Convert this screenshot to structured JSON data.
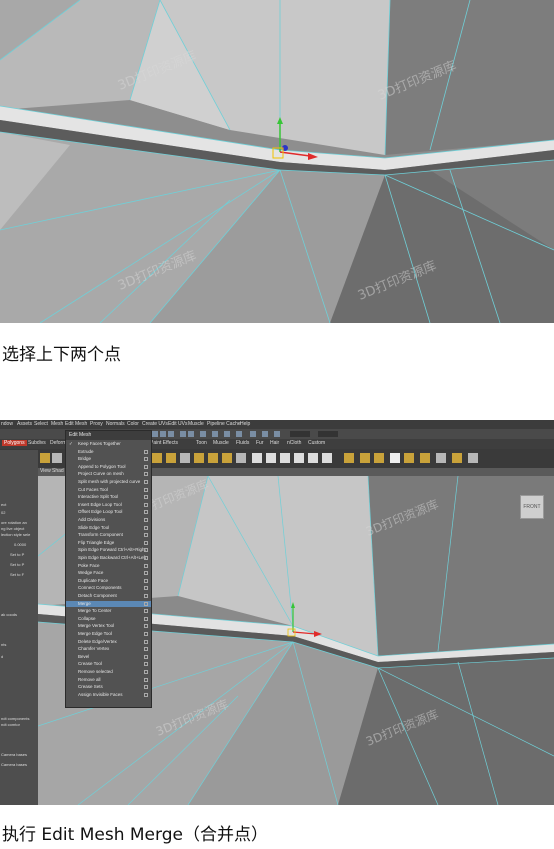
{
  "captions": {
    "step1": "选择上下两个点",
    "step2": "执行 Edit Mesh    Merge（合并点）"
  },
  "maya": {
    "menubar": [
      "ndow",
      "Assets",
      "Select",
      "Mesh",
      "Edit Mesh",
      "Proxy",
      "Normals",
      "Color",
      "Create UVs",
      "Edit UVs",
      "Muscle",
      "Pipeline Cache",
      "Help"
    ],
    "shelf_tabs": [
      "Polygons",
      "Subdivs",
      "Deform"
    ],
    "shelf_tabs_right": [
      "Fluids",
      "Fur",
      "Hair",
      "nCloth",
      "Custom",
      "Paint Effects",
      "Toon",
      "Muscle"
    ],
    "viewcube_label": "FRONT",
    "left_panel": [
      "ect",
      "02",
      "ore rotation an",
      "ng live object",
      "lection style sele",
      "0.0000",
      "Set to P",
      "Set to P",
      "Set to F",
      "ak coods",
      "nts",
      "d",
      "ndt components",
      "ndt comtor",
      "Camera bases",
      "Camera bases"
    ],
    "viewport_menu": [
      "View",
      "Shad"
    ],
    "edit_mesh_menu": {
      "title": "Edit Mesh",
      "highlighted": "Merge",
      "items": [
        "Keep Faces Together",
        "Extrude",
        "Bridge",
        "Append to Polygon Tool",
        "Project Curve on mesh",
        "Split mesh with projected curve",
        "Cut Faces Tool",
        "Interactive Split Tool",
        "Insert Edge Loop Tool",
        "Offset Edge Loop Tool",
        "Add Divisions",
        "Slide Edge Tool",
        "Transform Component",
        "Flip Triangle Edge",
        "Spin Edge Forward Ctrl+Alt+Right",
        "Spin Edge Backward Ctrl+Alt+Left",
        "Poke Face",
        "Wedge Face",
        "Duplicate Face",
        "Connect Components",
        "Detach Component",
        "Merge",
        "Merge To Center",
        "Collapse",
        "Merge Vertex Tool",
        "Merge Edge Tool",
        "Delete Edge/Vertex",
        "Chamfer Vertex",
        "Bevel",
        "Crease Tool",
        "Remove selected",
        "Remove all",
        "Crease Sets",
        "Assign Invisible Faces"
      ]
    }
  },
  "watermark": "3D打印资源库 www.3dzyk.cn"
}
